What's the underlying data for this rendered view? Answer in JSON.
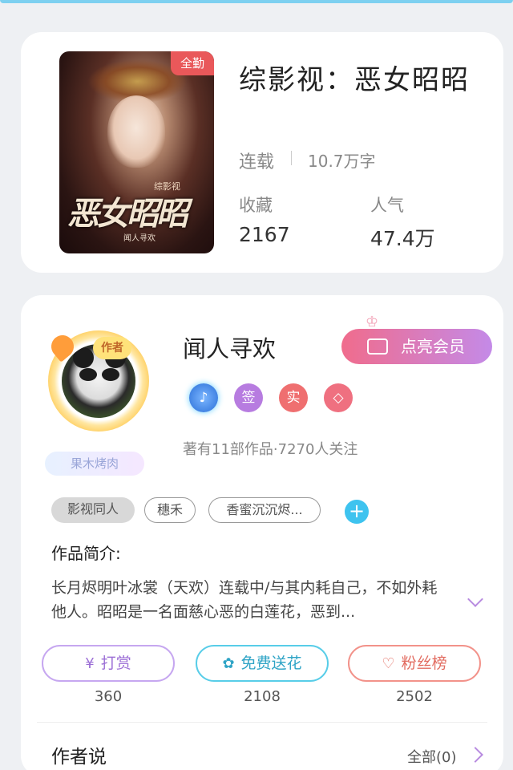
{
  "book": {
    "cover_tag": "全勤",
    "cover_calligraphy": "恶女昭昭",
    "cover_series": "综影视",
    "cover_author": "闻人寻欢",
    "title": "综影视：恶女昭昭",
    "status": "连载",
    "word_count": "10.7万字",
    "stats": [
      {
        "label": "收藏",
        "value": "2167"
      },
      {
        "label": "人气",
        "value": "47.4万"
      }
    ]
  },
  "author": {
    "avatar_badge": "作者",
    "pendant_tag": "果木烤肉",
    "name": "闻人寻欢",
    "vip_button": "点亮会员",
    "badges": [
      "签",
      "实"
    ],
    "works_info": "著有11部作品·7270人关注"
  },
  "tags": [
    "影视同人",
    "穗禾",
    "香蜜沉沉烬..."
  ],
  "intro": {
    "title": "作品简介:",
    "text": "长月烬明叶冰裳（天欢）连载中/与其内耗自己，不如外耗他人。昭昭是一名面慈心恶的白莲花，恶到..."
  },
  "actions": [
    {
      "label": "打赏",
      "icon": "yen-icon",
      "count": "360"
    },
    {
      "label": "免费送花",
      "icon": "flower-icon",
      "count": "2108"
    },
    {
      "label": "粉丝榜",
      "icon": "fans-icon",
      "count": "2502"
    }
  ],
  "author_say": {
    "title": "作者说",
    "all_label": "全部(0)"
  }
}
